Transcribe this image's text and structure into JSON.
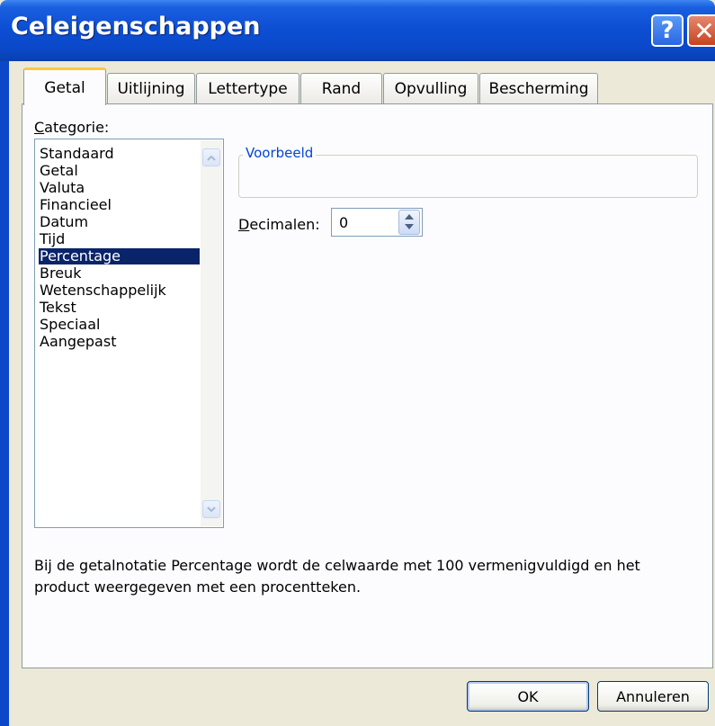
{
  "window": {
    "title": "Celeigenschappen"
  },
  "titlebar": {
    "help_label": "?",
    "close_label": "✕"
  },
  "tabs": [
    {
      "label": "Getal",
      "active": true
    },
    {
      "label": "Uitlijning",
      "active": false
    },
    {
      "label": "Lettertype",
      "active": false
    },
    {
      "label": "Rand",
      "active": false
    },
    {
      "label": "Opvulling",
      "active": false
    },
    {
      "label": "Bescherming",
      "active": false
    }
  ],
  "category": {
    "label_accel": "C",
    "label_rest": "ategorie:",
    "items": [
      "Standaard",
      "Getal",
      "Valuta",
      "Financieel",
      "Datum",
      "Tijd",
      "Percentage",
      "Breuk",
      "Wetenschappelijk",
      "Tekst",
      "Speciaal",
      "Aangepast"
    ],
    "selected": "Percentage"
  },
  "sample": {
    "label": "Voorbeeld",
    "value": ""
  },
  "decimals": {
    "label_accel": "D",
    "label_rest": "ecimalen:",
    "value": "0"
  },
  "description": "Bij de getalnotatie Percentage wordt de celwaarde met 100 vermenigvuldigd en het product weergegeven met een procentteken.",
  "buttons": {
    "ok": "OK",
    "cancel": "Annuleren"
  },
  "icons": {
    "scroll_up": "scroll-up-icon",
    "scroll_down": "scroll-down-icon",
    "spin": "spin-updown-icon"
  },
  "colors": {
    "titlebar": "#0a48c8",
    "selection": "#0a246a",
    "tab_highlight": "#ffc83c",
    "group_label": "#0046d5",
    "dialog_bg": "#ece9d8"
  }
}
